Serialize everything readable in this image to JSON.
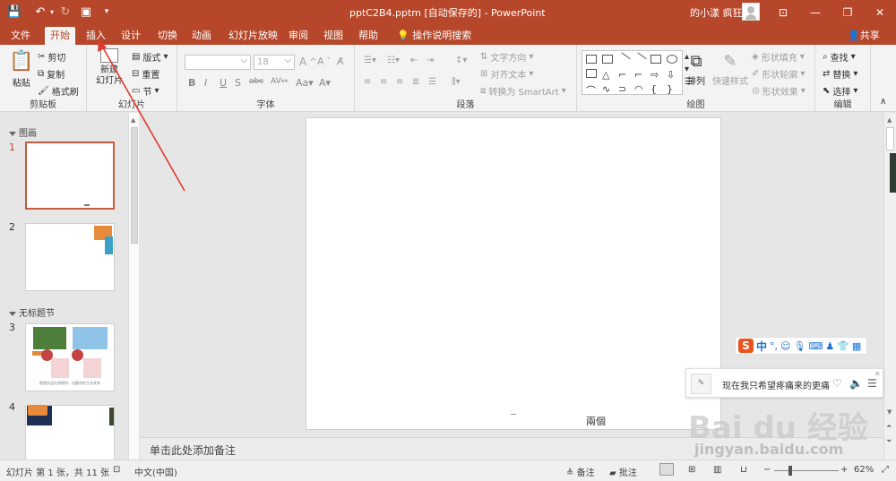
{
  "window": {
    "title": "pptC2B4.pptm [自动保存的]  -  PowerPoint",
    "user": "的小漾 疯狂"
  },
  "tabs": [
    "文件",
    "开始",
    "插入",
    "设计",
    "切换",
    "动画",
    "幻灯片放映",
    "审阅",
    "视图",
    "帮助",
    "操作说明搜索"
  ],
  "share_label": "共享",
  "ribbon": {
    "clipboard": {
      "label": "剪贴板",
      "paste": "粘贴",
      "cut": "剪切",
      "copy": "复制",
      "format_painter": "格式刷"
    },
    "slides": {
      "label": "幻灯片",
      "new_slide": "新建\n幻灯片",
      "layout": "版式",
      "reset": "重置",
      "section": "节"
    },
    "font": {
      "label": "字体",
      "size": "18"
    },
    "paragraph": {
      "label": "段落",
      "text_direction": "文字方向",
      "align_text": "对齐文本",
      "smartart": "转换为 SmartArt"
    },
    "drawing": {
      "label": "绘图",
      "arrange": "排列",
      "quick_styles": "快速样式",
      "fill": "形状填充",
      "outline": "形状轮廓",
      "effects": "形状效果"
    },
    "editing": {
      "label": "编辑",
      "find": "查找",
      "replace": "替换",
      "select": "选择"
    }
  },
  "thumbnails": {
    "sections": [
      "图画",
      "无标题节"
    ],
    "slides": [
      "1",
      "2",
      "3",
      "4"
    ],
    "slide3_caption": "图画作品在排版时，也要讲究主次关系"
  },
  "slide": {
    "footer_text": "兩個"
  },
  "notes": {
    "placeholder": "单击此处添加备注"
  },
  "status": {
    "slide_info": "幻灯片 第 1 张，共 11 张",
    "language": "中文(中国)",
    "notes": "备注",
    "comments": "批注",
    "zoom": "62%"
  },
  "ime": {
    "mode": "中"
  },
  "music": {
    "text": "现在我只希望疼痛来的更痛"
  },
  "watermark": {
    "brand": "Bai du 经验",
    "url": "jingyan.baidu.com"
  },
  "colors": {
    "accent": "#b7472a",
    "annotation": "#e03a2f"
  }
}
